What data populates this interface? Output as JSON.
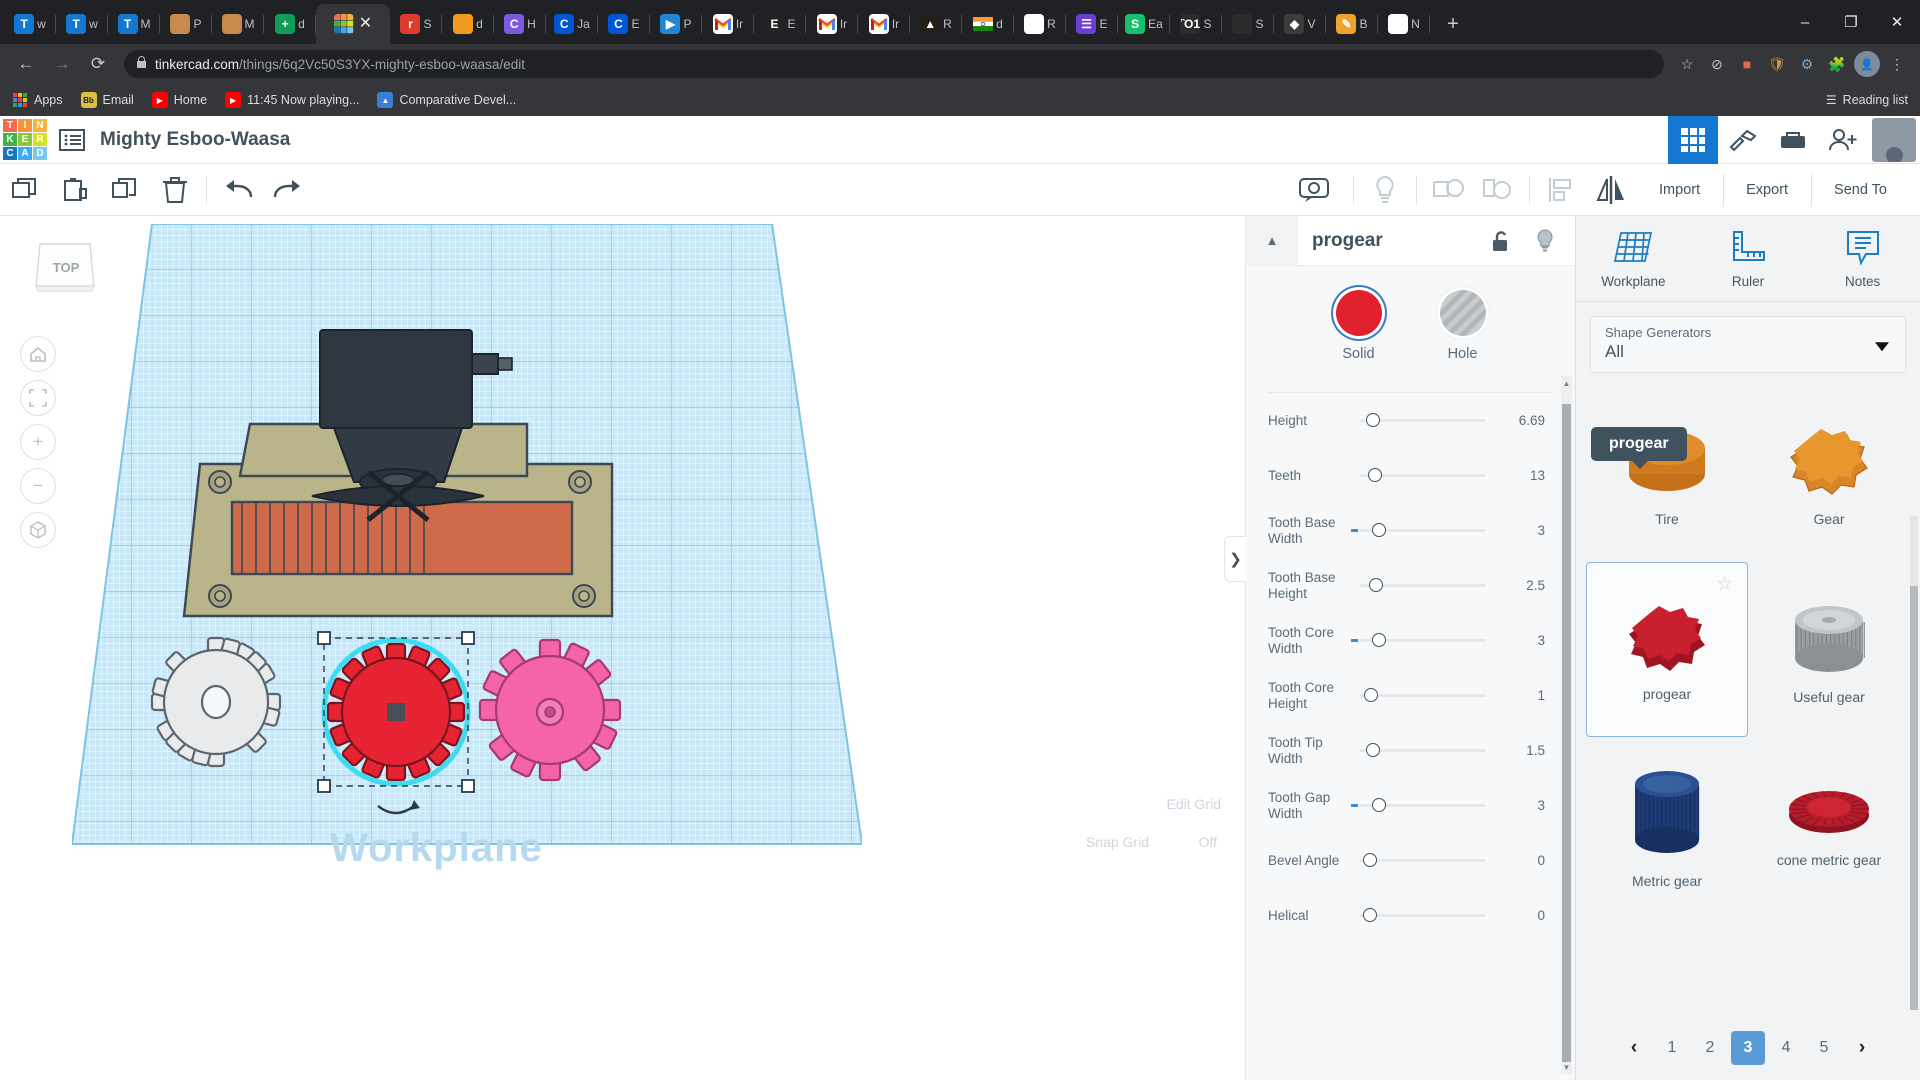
{
  "browser": {
    "tabs": [
      {
        "title": "w",
        "icon": "tinkercad-blue-icon",
        "color": "#1477d1",
        "glyph": "T",
        "active": false
      },
      {
        "title": "w",
        "icon": "tinkercad-blue-icon",
        "color": "#1477d1",
        "glyph": "T",
        "active": false
      },
      {
        "title": "M",
        "icon": "tinkercad-blue-icon",
        "color": "#1477d1",
        "glyph": "T",
        "active": false
      },
      {
        "title": "P",
        "icon": "photo-icon",
        "color": "#c98b4b",
        "glyph": "",
        "active": false
      },
      {
        "title": "M",
        "icon": "photo-icon",
        "color": "#c98b4b",
        "glyph": "",
        "active": false
      },
      {
        "title": "d",
        "icon": "sheets-green-icon",
        "color": "#0f9d58",
        "glyph": "+",
        "active": false
      },
      {
        "title": "",
        "icon": "tinkercad-logo-icon",
        "color": "#ffffff",
        "glyph": "",
        "active": true
      },
      {
        "title": "S",
        "icon": "red-pin-icon",
        "color": "#e03b2f",
        "glyph": "r",
        "active": false
      },
      {
        "title": "d",
        "icon": "orange-tree-icon",
        "color": "#f29a1b",
        "glyph": "",
        "active": false
      },
      {
        "title": "H",
        "icon": "canva-icon",
        "color": "#7b5ae0",
        "glyph": "C",
        "active": false
      },
      {
        "title": "Ja",
        "icon": "coursera-icon",
        "color": "#0056d2",
        "glyph": "C",
        "active": false
      },
      {
        "title": "E",
        "icon": "coursera-icon",
        "color": "#0056d2",
        "glyph": "C",
        "active": false
      },
      {
        "title": "P",
        "icon": "youtube-icon",
        "color": "#1f86d8",
        "glyph": "▶",
        "active": false
      },
      {
        "title": "Ir",
        "icon": "gmail-icon",
        "color": "#ffffff",
        "glyph": "M",
        "active": false
      },
      {
        "title": "E",
        "icon": "etsy-icon",
        "color": "#222222",
        "glyph": "E",
        "active": false
      },
      {
        "title": "Ir",
        "icon": "gmail-icon",
        "color": "#ffffff",
        "glyph": "M",
        "active": false
      },
      {
        "title": "Ir",
        "icon": "gmail-icon",
        "color": "#ffffff",
        "glyph": "M",
        "active": false
      },
      {
        "title": "R",
        "icon": "badge-dark-icon",
        "color": "#241f17",
        "glyph": "▲",
        "active": false
      },
      {
        "title": "d",
        "icon": "india-flag-icon",
        "color": "#ff9933",
        "glyph": "",
        "active": false
      },
      {
        "title": "R",
        "icon": "grid-dots-icon",
        "color": "#ffffff",
        "glyph": "⁙",
        "active": false
      },
      {
        "title": "E",
        "icon": "list-purple-icon",
        "color": "#6d3cd4",
        "glyph": "☰",
        "active": false
      },
      {
        "title": "Ea",
        "icon": "spotify-green-icon",
        "color": "#19c06a",
        "glyph": "S",
        "active": false
      },
      {
        "title": "S",
        "icon": "bulb-icon",
        "color": "#2b2b2b",
        "glyph": "Ὂ1",
        "active": false
      },
      {
        "title": "S",
        "icon": "bulb-icon",
        "color": "#2b2b2b",
        "glyph": "",
        "active": false
      },
      {
        "title": "V",
        "icon": "shield-icon",
        "color": "#3c3c3c",
        "glyph": "◆",
        "active": false
      },
      {
        "title": "B",
        "icon": "pencil-orange-icon",
        "color": "#f0a32a",
        "glyph": "✎",
        "active": false
      },
      {
        "title": "N",
        "icon": "chrome-icon",
        "color": "#ffffff",
        "glyph": "◎",
        "active": false
      }
    ],
    "newtab_label": "+",
    "window": {
      "minimize": "–",
      "maximize": "❐",
      "close": "✕"
    },
    "nav": {
      "back": "←",
      "forward": "→",
      "reload": "⟳"
    },
    "url": {
      "lock": "ὑ2",
      "domain": "tinkercad.com",
      "path": "/things/6q2Vc50S3YX-mighty-esboo-waasa/edit"
    },
    "omni_icons": [
      "star-icon",
      "block-icon",
      "extension-red-icon",
      "shield-icon",
      "puzzle-icon",
      "jigsaw-icon",
      "menu-dots-icon"
    ],
    "bookmarks": [
      {
        "label": "Apps",
        "icon": "apps-grid-icon",
        "color": "#ffffff"
      },
      {
        "label": "Email",
        "icon": "blackboard-icon",
        "color": "#d8c13c"
      },
      {
        "label": "Home",
        "icon": "youtube-icon",
        "color": "#ff0000"
      },
      {
        "label": "11:45 Now playing...",
        "icon": "youtube-icon",
        "color": "#ff0000"
      },
      {
        "label": "Comparative Devel...",
        "icon": "drive-icon",
        "color": "#3b7fd4"
      }
    ],
    "reading_list": {
      "label": "Reading list",
      "icon": "reading-list-icon"
    }
  },
  "tinkercad": {
    "logo_tiles": [
      {
        "t": "T",
        "c": "#f26b4d"
      },
      {
        "t": "I",
        "c": "#f7933c"
      },
      {
        "t": "N",
        "c": "#f7b23c"
      },
      {
        "t": "K",
        "c": "#3db54a"
      },
      {
        "t": "E",
        "c": "#8cc63f"
      },
      {
        "t": "R",
        "c": "#d7e021"
      },
      {
        "t": "C",
        "c": "#1b75bb"
      },
      {
        "t": "A",
        "c": "#3fa9f5"
      },
      {
        "t": "D",
        "c": "#7bc8ef"
      }
    ],
    "project_title": "Mighty Esboo-Waasa",
    "header_icons": [
      "grid-view-icon",
      "design-hammer-icon",
      "blocks-icon",
      "add-user-icon",
      "avatar"
    ],
    "toolbar": {
      "left_icons": [
        "copy-icon",
        "paste-icon",
        "duplicate-icon",
        "delete-icon",
        "undo-icon",
        "redo-icon"
      ],
      "mid_icons": [
        "show-all-icon",
        "light-bulb-icon",
        "group-icon",
        "ungroup-icon",
        "align-icon",
        "mirror-icon"
      ],
      "buttons": [
        "Import",
        "Export",
        "Send To"
      ]
    },
    "viewport": {
      "viewcube_label": "TOP",
      "nav_icons": [
        "home-icon",
        "fit-view-icon",
        "zoom-in-icon",
        "zoom-out-icon",
        "ortho-icon"
      ],
      "workplane_label": "Workplane",
      "edit_grid_label": "Edit Grid",
      "snap_grid_label": "Snap Grid",
      "snap_grid_value": "Off"
    },
    "properties": {
      "collapse_icon": "chevron-up-icon",
      "name": "progear",
      "lock_icon": "unlock-icon",
      "bulb_icon": "light-bulb-icon",
      "solid_label": "Solid",
      "hole_label": "Hole",
      "solid_color": "#e1212f",
      "sliders": [
        {
          "label": "Height",
          "value": "6.69",
          "knob": 6,
          "fill": false
        },
        {
          "label": "Teeth",
          "value": "13",
          "knob": 8,
          "fill": false
        },
        {
          "label": "Tooth Base Width",
          "value": "3",
          "knob": 12,
          "fill": true
        },
        {
          "label": "Tooth Base Height",
          "value": "2.5",
          "knob": 9,
          "fill": false
        },
        {
          "label": "Tooth Core Width",
          "value": "3",
          "knob": 12,
          "fill": true
        },
        {
          "label": "Tooth Core Height",
          "value": "1",
          "knob": 4,
          "fill": false
        },
        {
          "label": "Tooth Tip Width",
          "value": "1.5",
          "knob": 6,
          "fill": false
        },
        {
          "label": "Tooth Gap Width",
          "value": "3",
          "knob": 12,
          "fill": true
        },
        {
          "label": "Bevel Angle",
          "value": "0",
          "knob": 3,
          "fill": false
        },
        {
          "label": "Helical",
          "value": "0",
          "knob": 3,
          "fill": false
        }
      ]
    },
    "sidebar": {
      "tools": [
        {
          "label": "Workplane",
          "icon": "workplane-icon"
        },
        {
          "label": "Ruler",
          "icon": "ruler-icon"
        },
        {
          "label": "Notes",
          "icon": "notes-icon"
        }
      ],
      "select_caption": "Shape Generators",
      "select_value": "All",
      "tooltip": "progear",
      "shapes": [
        {
          "name": "Tire",
          "icon": "tire-shape",
          "selected": false
        },
        {
          "name": "Gear",
          "icon": "gear-shape",
          "selected": false
        },
        {
          "name": "progear",
          "icon": "progear-shape",
          "selected": true
        },
        {
          "name": "Useful gear",
          "icon": "useful-gear-shape",
          "selected": false
        },
        {
          "name": "Metric gear",
          "icon": "metric-gear-shape",
          "selected": false
        },
        {
          "name": "cone metric gear",
          "icon": "cone-metric-gear-shape",
          "selected": false
        }
      ],
      "pager": {
        "prev": "‹",
        "pages": [
          "1",
          "2",
          "3",
          "4",
          "5"
        ],
        "active": "3",
        "next": "›"
      }
    }
  }
}
